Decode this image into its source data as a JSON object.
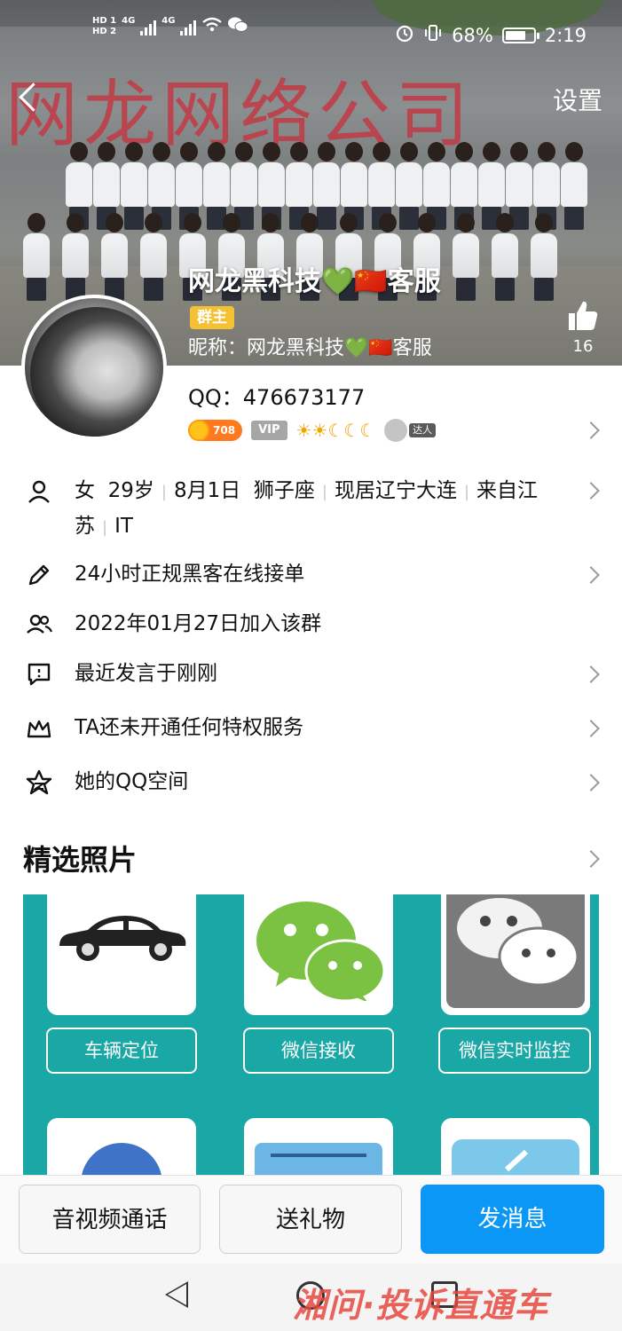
{
  "status_bar": {
    "hd1": "HD 1",
    "hd2": "HD 2",
    "net1": "4G",
    "net2": "4G",
    "battery": "68%",
    "time": "2:19"
  },
  "header": {
    "back_icon": "chevron-left-icon",
    "settings_label": "设置",
    "banner_text": "网龙网络公司",
    "display_name": "网龙黑科技💚🇨🇳客服",
    "owner_badge": "群主",
    "nickname_label": "昵称：",
    "nickname_value": "网龙黑科技💚🇨🇳客服",
    "like_count": "16"
  },
  "profile": {
    "qq_label": "QQ：",
    "qq_number": "476673177",
    "coin_value": "708",
    "vip_label": "VIP",
    "level_icons": "☀☀☾☾☾",
    "talent_label": "达人"
  },
  "details": {
    "gender": "女",
    "age": "29岁",
    "birthday": "8月1日",
    "zodiac": "狮子座",
    "location": "现居辽宁大连",
    "origin": "来自江苏",
    "job": "IT",
    "signature": "24小时正规黑客在线接单",
    "joined": "2022年01月27日加入该群",
    "last_spoke": "最近发言于刚刚",
    "privilege": "TA还未开通任何特权服务",
    "qzone": "她的QQ空间"
  },
  "photos": {
    "title": "精选照片",
    "captions": [
      "车辆定位",
      "微信接收",
      "微信实时监控"
    ],
    "colors": {
      "background": "#19a8a6"
    }
  },
  "actions": {
    "call": "音视频通话",
    "gift": "送礼物",
    "message": "发消息"
  },
  "watermark": "湘问·投诉直通车",
  "colors": {
    "primary": "#0a97f5",
    "owner_badge": "#f5c034"
  }
}
